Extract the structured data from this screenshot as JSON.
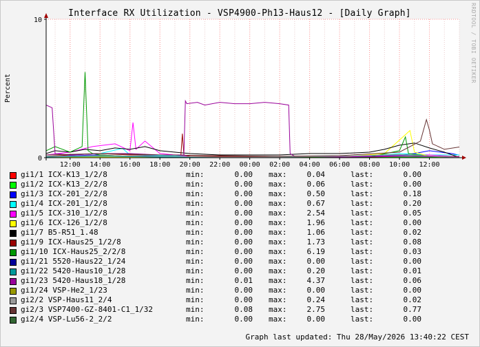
{
  "watermark": "RRDTOOL / TOBI OETIKER",
  "updated": "Graph last updated: Thu 28/May/2026 13:40:22 CEST",
  "legend_labels": {
    "min": "min:",
    "max": "max:",
    "last": "last:"
  },
  "chart_data": {
    "type": "line",
    "title": "Interface RX Utilization - VSP4900-Ph13-Haus12 - [Daily Graph]",
    "ylabel": "Percent",
    "xlabel": "",
    "ylim": [
      0,
      10
    ],
    "yticks": [
      0,
      10
    ],
    "xlim": [
      10.4,
      38.0
    ],
    "xticks": [
      12,
      14,
      16,
      18,
      20,
      22,
      24,
      26,
      28,
      30,
      32,
      34,
      36
    ],
    "xtick_labels": [
      "12:00",
      "14:00",
      "16:00",
      "18:00",
      "20:00",
      "22:00",
      "00:00",
      "02:00",
      "04:00",
      "06:00",
      "08:00",
      "10:00",
      "12:00"
    ],
    "grid": true,
    "legend_position": "bottom",
    "series": [
      {
        "name": "gi1/1 ICX-K13_1/2/8",
        "color": "#ff0000",
        "min": "0.00",
        "max": "0.04",
        "last": "0.00",
        "x": [
          10.4,
          14,
          18,
          22,
          26,
          30,
          34,
          38
        ],
        "y": [
          0.01,
          0.02,
          0.01,
          0.02,
          0.01,
          0.02,
          0.03,
          0.01
        ]
      },
      {
        "name": "gi1/2 ICX-K13_2/2/8",
        "color": "#00ff00",
        "min": "0.00",
        "max": "0.06",
        "last": "0.00",
        "x": [
          10.4,
          14,
          18,
          22,
          26,
          30,
          34,
          38
        ],
        "y": [
          0.02,
          0.04,
          0.02,
          0.03,
          0.02,
          0.03,
          0.05,
          0.01
        ]
      },
      {
        "name": "gi1/3 ICX-201_2/2/8",
        "color": "#0000ff",
        "min": "0.00",
        "max": "0.50",
        "last": "0.18",
        "x": [
          10.4,
          12,
          14,
          16,
          18,
          20,
          22,
          24,
          26,
          28,
          30,
          32,
          34,
          35,
          36,
          37.5,
          38
        ],
        "y": [
          0.1,
          0.15,
          0.2,
          0.1,
          0.15,
          0.1,
          0.05,
          0.08,
          0.05,
          0.06,
          0.08,
          0.12,
          0.2,
          0.3,
          0.5,
          0.3,
          0.18
        ]
      },
      {
        "name": "gi1/4 ICX-201_1/2/8",
        "color": "#00ffff",
        "min": "0.00",
        "max": "0.67",
        "last": "0.20",
        "x": [
          10.4,
          12,
          14,
          15.5,
          16,
          18,
          20,
          24,
          28,
          32,
          34,
          36,
          38
        ],
        "y": [
          0.1,
          0.2,
          0.3,
          0.67,
          0.2,
          0.15,
          0.1,
          0.08,
          0.1,
          0.12,
          0.3,
          0.2,
          0.2
        ]
      },
      {
        "name": "gi1/5 ICX-310_1/2/8",
        "color": "#ff00ff",
        "min": "0.00",
        "max": "2.54",
        "last": "0.05",
        "x": [
          10.4,
          12,
          13.5,
          15,
          16,
          16.2,
          16.4,
          17,
          18,
          20,
          24,
          28,
          32,
          36,
          38
        ],
        "y": [
          0.2,
          0.4,
          0.8,
          1.0,
          0.5,
          2.54,
          0.6,
          1.2,
          0.3,
          0.1,
          0.05,
          0.05,
          0.1,
          0.2,
          0.05
        ]
      },
      {
        "name": "gi1/6 ICX-126_1/2/8",
        "color": "#ffff00",
        "min": "0.00",
        "max": "1.96",
        "last": "0.00",
        "x": [
          10.4,
          14,
          18,
          22,
          26,
          30,
          33,
          34.7,
          35,
          36,
          38
        ],
        "y": [
          0.02,
          0.05,
          0.02,
          0.01,
          0.02,
          0.05,
          0.3,
          1.96,
          0.4,
          0.1,
          0.0
        ]
      },
      {
        "name": "gi1/7 B5-R51_1.48",
        "color": "#000000",
        "min": "0.00",
        "max": "1.06",
        "last": "0.02",
        "x": [
          10.4,
          11,
          12,
          13,
          14,
          15,
          16,
          17,
          18,
          19,
          20,
          22,
          24,
          26,
          28,
          30,
          32,
          33,
          34,
          35,
          36,
          37,
          38
        ],
        "y": [
          0.3,
          0.5,
          0.4,
          0.6,
          0.5,
          0.7,
          0.6,
          0.8,
          0.5,
          0.4,
          0.3,
          0.2,
          0.2,
          0.2,
          0.3,
          0.3,
          0.4,
          0.6,
          0.9,
          1.06,
          0.7,
          0.4,
          0.02
        ]
      },
      {
        "name": "gi1/9 ICX-Haus25_1/2/8",
        "color": "#990000",
        "min": "0.00",
        "max": "1.73",
        "last": "0.08",
        "x": [
          10.4,
          12,
          14,
          16,
          18,
          19.4,
          19.5,
          19.6,
          20,
          22,
          24,
          26,
          28,
          30,
          32,
          34,
          36,
          38
        ],
        "y": [
          0.1,
          0.2,
          0.3,
          0.2,
          0.2,
          0.2,
          1.73,
          0.2,
          0.1,
          0.1,
          0.1,
          0.05,
          0.05,
          0.05,
          0.05,
          0.1,
          0.1,
          0.08
        ]
      },
      {
        "name": "gi1/10 ICX-Haus25_2/2/8",
        "color": "#009900",
        "min": "0.00",
        "max": "6.19",
        "last": "0.03",
        "x": [
          10.4,
          11,
          12,
          12.8,
          13,
          13.2,
          13.5,
          14,
          16,
          18,
          20,
          24,
          28,
          32,
          34,
          34.4,
          34.6,
          36,
          38
        ],
        "y": [
          0.5,
          0.8,
          0.4,
          0.8,
          6.19,
          0.5,
          0.3,
          0.2,
          0.1,
          0.05,
          0.02,
          0.02,
          0.02,
          0.05,
          0.5,
          1.5,
          0.3,
          0.1,
          0.03
        ]
      },
      {
        "name": "gi1/21 5520-Haus22_1/24",
        "color": "#000099",
        "min": "0.00",
        "max": "0.00",
        "last": "0.00",
        "x": [
          10.4,
          38
        ],
        "y": [
          0.0,
          0.0
        ]
      },
      {
        "name": "gi1/22 5420-Haus10_1/28",
        "color": "#009999",
        "min": "0.00",
        "max": "0.20",
        "last": "0.01",
        "x": [
          10.4,
          14,
          18,
          22,
          26,
          30,
          34,
          38
        ],
        "y": [
          0.05,
          0.1,
          0.05,
          0.05,
          0.05,
          0.1,
          0.2,
          0.01
        ]
      },
      {
        "name": "gi1/23 5420-Haus18_1/28",
        "color": "#990099",
        "min": "0.01",
        "max": "4.37",
        "last": "0.06",
        "x": [
          10.4,
          10.8,
          11.0,
          12,
          14,
          16,
          18,
          19.6,
          19.7,
          19.8,
          20.5,
          21,
          22,
          23,
          24,
          25,
          26,
          26.6,
          26.7,
          27,
          30,
          34,
          38
        ],
        "y": [
          3.8,
          3.6,
          0.3,
          0.2,
          0.3,
          0.3,
          0.2,
          0.2,
          4.1,
          3.9,
          4.0,
          3.8,
          4.0,
          3.9,
          3.9,
          4.0,
          3.9,
          3.8,
          0.3,
          0.1,
          0.05,
          0.1,
          0.06
        ]
      },
      {
        "name": "gi1/24 VSP-He2_1/23",
        "color": "#999900",
        "min": "0.00",
        "max": "0.00",
        "last": "0.00",
        "x": [
          10.4,
          38
        ],
        "y": [
          0.0,
          0.0
        ]
      },
      {
        "name": "gi2/2 VSP-Haus11_2/4",
        "color": "#999999",
        "min": "0.00",
        "max": "0.24",
        "last": "0.02",
        "x": [
          10.4,
          14,
          18,
          22,
          26,
          30,
          34,
          38
        ],
        "y": [
          0.1,
          0.15,
          0.1,
          0.05,
          0.05,
          0.1,
          0.24,
          0.02
        ]
      },
      {
        "name": "gi2/3 VSP7400-GZ-8401-C1_1/32",
        "color": "#663333",
        "min": "0.08",
        "max": "2.75",
        "last": "0.77",
        "x": [
          10.4,
          14,
          18,
          22,
          26,
          30,
          34,
          35.4,
          35.8,
          36,
          36.2,
          37,
          38
        ],
        "y": [
          0.2,
          0.3,
          0.2,
          0.15,
          0.1,
          0.15,
          0.4,
          1.2,
          2.75,
          2.0,
          1.0,
          0.6,
          0.77
        ]
      },
      {
        "name": "gi2/4 VSP-Lu56-2_2/2",
        "color": "#336633",
        "min": "0.00",
        "max": "0.00",
        "last": "0.00",
        "x": [
          10.4,
          38
        ],
        "y": [
          0.0,
          0.0
        ]
      }
    ]
  }
}
